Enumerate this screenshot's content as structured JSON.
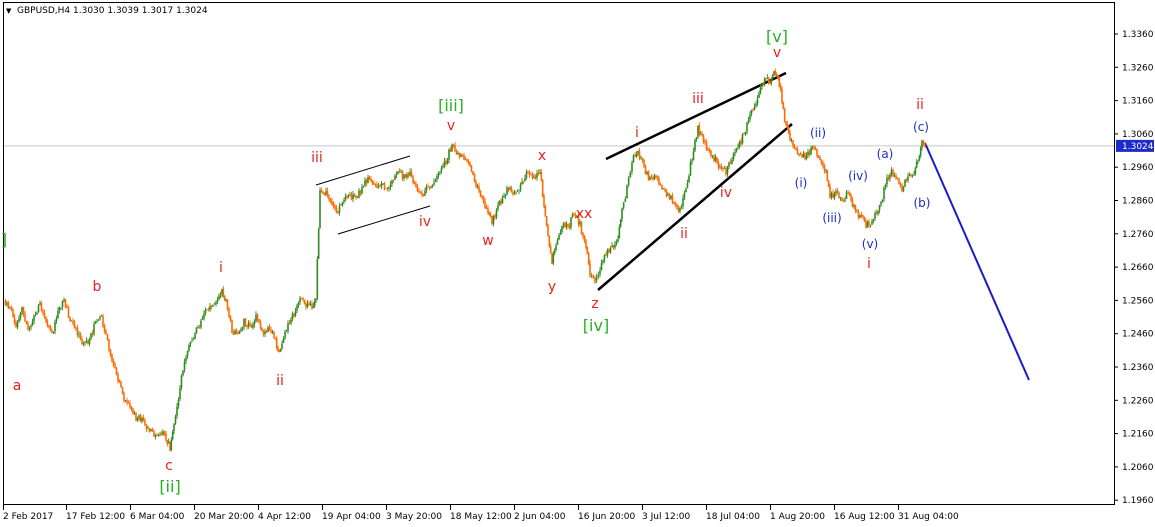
{
  "header": {
    "symbol_line": "GBPUSD,H4  1.3030 1.3039 1.3017 1.3024",
    "arrow": "▼"
  },
  "colors": {
    "up": "#2e8b1e",
    "down": "#ff6a00",
    "wave_red": "#e8231f",
    "wave_blue": "#1d2bc8",
    "wave_green": "#22b322",
    "projection": "#1a1ac8",
    "price_tag_bg": "#1d2bc8"
  },
  "chart_data": {
    "type": "candlestick",
    "symbol": "GBPUSD",
    "timeframe": "H4",
    "ohlc": {
      "open": 1.303,
      "high": 1.3039,
      "low": 1.3017,
      "close": 1.3024
    },
    "current_price": 1.3024,
    "current_price_label": "1.3024",
    "ylim": [
      1.196,
      1.342
    ],
    "y_ticks": [
      "1.3360",
      "1.3260",
      "1.3160",
      "1.3060",
      "1.2960",
      "1.2860",
      "1.2760",
      "1.2660",
      "1.2560",
      "1.2460",
      "1.2360",
      "1.2260",
      "1.2160",
      "1.2060",
      "1.1960"
    ],
    "y_tick_values": [
      1.336,
      1.326,
      1.316,
      1.306,
      1.296,
      1.286,
      1.276,
      1.266,
      1.256,
      1.246,
      1.236,
      1.226,
      1.216,
      1.206,
      1.196
    ],
    "x_ticks": [
      "2 Feb 2017",
      "17 Feb 12:00",
      "6 Mar 04:00",
      "20 Mar 20:00",
      "4 Apr 12:00",
      "19 Apr 04:00",
      "3 May 20:00",
      "18 May 12:00",
      "2 Jun 04:00",
      "16 Jun 20:00",
      "3 Jul 12:00",
      "18 Jul 04:00",
      "1 Aug 20:00",
      "16 Aug 12:00",
      "31 Aug 04:00"
    ],
    "x_tick_index": [
      0,
      1,
      2,
      3,
      4,
      5,
      6,
      7,
      8,
      9,
      10,
      11,
      12,
      13,
      14
    ],
    "bar_count": 148,
    "price_path": [
      [
        0,
        1.256
      ],
      [
        3,
        1.252
      ],
      [
        6,
        1.248
      ],
      [
        8,
        1.253
      ],
      [
        10,
        1.247
      ],
      [
        13,
        1.25
      ],
      [
        15,
        1.256
      ],
      [
        17,
        1.25
      ],
      [
        19,
        1.244
      ],
      [
        21,
        1.24
      ],
      [
        23,
        1.232
      ],
      [
        25,
        1.226
      ],
      [
        27,
        1.22
      ],
      [
        29,
        1.217
      ],
      [
        31,
        1.215
      ],
      [
        33,
        1.218
      ],
      [
        35,
        1.215
      ],
      [
        36,
        1.226
      ],
      [
        38,
        1.239
      ],
      [
        40,
        1.248
      ],
      [
        42,
        1.252
      ],
      [
        44,
        1.244
      ],
      [
        45,
        1.259
      ],
      [
        47,
        1.251
      ],
      [
        48,
        1.246
      ],
      [
        50,
        1.25
      ],
      [
        52,
        1.244
      ],
      [
        54,
        1.248
      ],
      [
        56,
        1.242
      ],
      [
        58,
        1.249
      ],
      [
        60,
        1.255
      ],
      [
        62,
        1.256
      ],
      [
        63,
        1.258
      ],
      [
        64,
        1.289
      ],
      [
        66,
        1.282
      ],
      [
        68,
        1.285
      ],
      [
        70,
        1.28
      ],
      [
        72,
        1.287
      ],
      [
        74,
        1.29
      ],
      [
        76,
        1.286
      ],
      [
        78,
        1.29
      ],
      [
        80,
        1.295
      ],
      [
        82,
        1.288
      ],
      [
        84,
        1.292
      ],
      [
        86,
        1.295
      ],
      [
        88,
        1.297
      ],
      [
        90,
        1.301
      ],
      [
        92,
        1.299
      ],
      [
        94,
        1.294
      ],
      [
        96,
        1.283
      ],
      [
        98,
        1.287
      ],
      [
        100,
        1.29
      ],
      [
        102,
        1.294
      ],
      [
        104,
        1.291
      ],
      [
        106,
        1.292
      ],
      [
        107,
        1.287
      ],
      [
        108,
        1.278
      ],
      [
        110,
        1.28
      ],
      [
        112,
        1.276
      ],
      [
        114,
        1.27
      ],
      [
        115,
        1.262
      ]
    ],
    "annotations": [
      {
        "text": "a",
        "color": "red"
      },
      {
        "text": "b",
        "color": "red"
      },
      {
        "text": "c",
        "color": "red"
      },
      {
        "text": "[ii]",
        "color": "green"
      },
      {
        "text": "i",
        "color": "red"
      },
      {
        "text": "ii",
        "color": "red"
      },
      {
        "text": "iii",
        "color": "red"
      },
      {
        "text": "iv",
        "color": "red"
      },
      {
        "text": "v",
        "color": "red"
      },
      {
        "text": "[iii]",
        "color": "green"
      },
      {
        "text": "w",
        "color": "red"
      },
      {
        "text": "x",
        "color": "red"
      },
      {
        "text": "xx",
        "color": "red"
      },
      {
        "text": "y",
        "color": "red"
      },
      {
        "text": "z",
        "color": "red"
      },
      {
        "text": "[iv]",
        "color": "green"
      },
      {
        "text": "i",
        "color": "red"
      },
      {
        "text": "ii",
        "color": "red"
      },
      {
        "text": "iii",
        "color": "red"
      },
      {
        "text": "iv",
        "color": "red"
      },
      {
        "text": "v",
        "color": "red"
      },
      {
        "text": "[v]",
        "color": "green"
      },
      {
        "text": "(i)",
        "color": "blue"
      },
      {
        "text": "(ii)",
        "color": "blue"
      },
      {
        "text": "(iii)",
        "color": "blue"
      },
      {
        "text": "(iv)",
        "color": "blue"
      },
      {
        "text": "(v)",
        "color": "blue"
      },
      {
        "text": "i",
        "color": "red"
      },
      {
        "text": "(a)",
        "color": "blue"
      },
      {
        "text": "(b)",
        "color": "blue"
      },
      {
        "text": "(c)",
        "color": "blue"
      },
      {
        "text": "ii",
        "color": "red"
      },
      {
        "text": "]",
        "color": "green"
      }
    ]
  }
}
